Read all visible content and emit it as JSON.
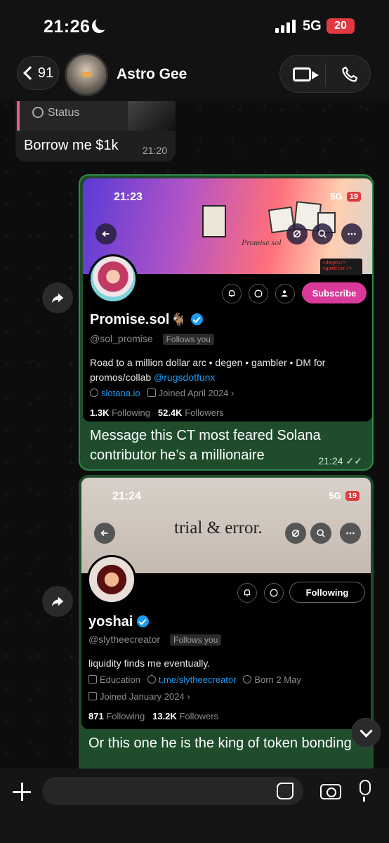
{
  "status_bar": {
    "time": "21:26",
    "network": "5G",
    "battery": "20"
  },
  "header": {
    "back_count": "91",
    "contact_name": "Astro Gee"
  },
  "incoming": {
    "quote_label": "Status",
    "text": "Borrow me $1k",
    "time": "21:20"
  },
  "forward1": {
    "shot": {
      "time": "21:23",
      "network": "5G",
      "battery": "19",
      "brand_script": "Promise.sol",
      "sticky_note": "<degen/> <gambler/>",
      "name": "Promise.sol",
      "handle": "@sol_promise",
      "follows_you": "Follows you",
      "bio_text": "Road to a million dollar arc • degen • gambler • DM for promos/collab",
      "bio_link": "@rugsdotfunx",
      "website": "slotana.io",
      "joined": "Joined April 2024",
      "following_count": "1.3K",
      "following_label": "Following",
      "followers_count": "52.4K",
      "followers_label": "Followers",
      "cta": "Subscribe"
    },
    "caption": "Message this CT most feared Solana contributor he’s a millionaire",
    "time": "21:24"
  },
  "forward2": {
    "shot": {
      "time": "21:24",
      "network": "5G",
      "battery": "19",
      "banner_text": "trial & error.",
      "name": "yoshai",
      "handle": "@slytheecreator",
      "follows_you": "Follows you",
      "bio_text": "liquidity finds me eventually.",
      "category": "Education",
      "website": "t.me/slytheecreator",
      "born": "Born 2 May",
      "joined": "Joined January 2024",
      "following_count": "871",
      "following_label": "Following",
      "followers_count": "13.2K",
      "followers_label": "Followers",
      "cta": "Following"
    },
    "caption": "Or this one he is the king of token bonding"
  },
  "composer": {
    "placeholder": ""
  },
  "colors": {
    "outgoing_bubble": "#1f4d2c",
    "subscribe": "#d93a9a",
    "link": "#1d9bf0",
    "accent_border": "#2f8a46"
  }
}
